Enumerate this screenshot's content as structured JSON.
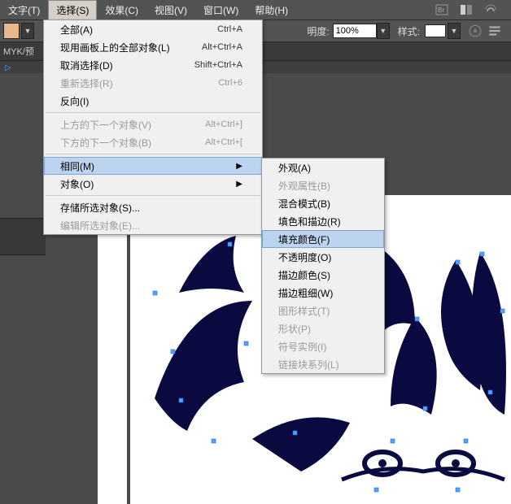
{
  "menubar": {
    "items": [
      {
        "label": "文字(T)"
      },
      {
        "label": "选择(S)"
      },
      {
        "label": "效果(C)"
      },
      {
        "label": "视图(V)"
      },
      {
        "label": "窗口(W)"
      },
      {
        "label": "帮助(H)"
      }
    ],
    "icons": [
      "br",
      "layout",
      "cloud"
    ]
  },
  "toolbar": {
    "opacity_label": "明度:",
    "opacity_value": "100%",
    "style_label": "样式:"
  },
  "tabbar": {
    "doc_label": "MYK/预"
  },
  "ruler": {
    "marker": "▷"
  },
  "dropdown": {
    "rows": [
      {
        "label": "全部(A)",
        "sc": "Ctrl+A",
        "disabled": false
      },
      {
        "label": "现用画板上的全部对象(L)",
        "sc": "Alt+Ctrl+A",
        "disabled": false
      },
      {
        "label": "取消选择(D)",
        "sc": "Shift+Ctrl+A",
        "disabled": false
      },
      {
        "label": "重新选择(R)",
        "sc": "Ctrl+6",
        "disabled": true
      },
      {
        "label": "反向(I)",
        "sc": "",
        "disabled": false
      }
    ],
    "rows2": [
      {
        "label": "上方的下一个对象(V)",
        "sc": "Alt+Ctrl+]",
        "disabled": true
      },
      {
        "label": "下方的下一个对象(B)",
        "sc": "Alt+Ctrl+[",
        "disabled": true
      }
    ],
    "rows3": [
      {
        "label": "相同(M)",
        "sc": "",
        "sub": true,
        "hl": true
      },
      {
        "label": "对象(O)",
        "sc": "",
        "sub": true
      }
    ],
    "rows4": [
      {
        "label": "存储所选对象(S)...",
        "sc": ""
      },
      {
        "label": "编辑所选对象(E)...",
        "sc": "",
        "disabled": true
      }
    ]
  },
  "submenu": {
    "rows": [
      {
        "label": "外观(A)"
      },
      {
        "label": "外观属性(B)",
        "disabled": true
      },
      {
        "label": "混合模式(B)"
      },
      {
        "label": "填色和描边(R)"
      },
      {
        "label": "填充颜色(F)",
        "hl": true
      },
      {
        "label": "不透明度(O)"
      },
      {
        "label": "描边颜色(S)"
      },
      {
        "label": "描边粗细(W)"
      },
      {
        "label": "图形样式(T)",
        "disabled": true
      },
      {
        "label": "形状(P)",
        "disabled": true
      },
      {
        "label": "符号实例(I)",
        "disabled": true
      },
      {
        "label": "链接块系列(L)",
        "disabled": true
      }
    ]
  }
}
